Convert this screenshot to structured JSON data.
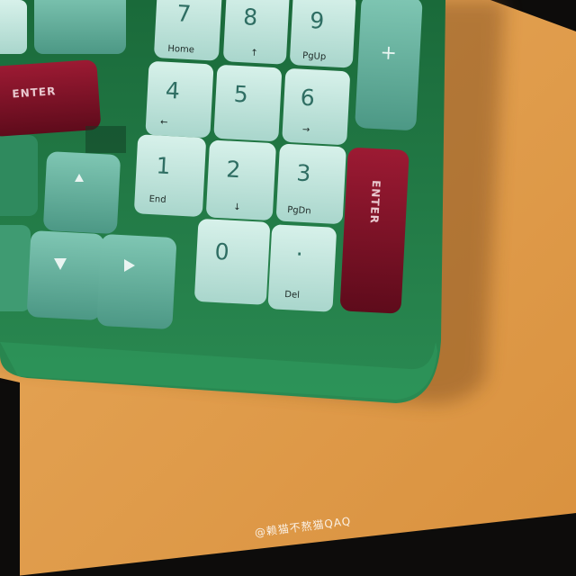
{
  "scene": {
    "subject": "keyboard-numpad-corner",
    "colors": {
      "case": "#1f7a45",
      "mint_key": "#b8dfd6",
      "sea_key": "#5fae9a",
      "red_key": "#7a1124",
      "desk": "#e3a14f",
      "legend": "#2f6e63"
    }
  },
  "keys": {
    "k7": {
      "main": "7",
      "sub": "Home"
    },
    "k8": {
      "main": "8",
      "sub": "↑"
    },
    "k9": {
      "main": "9",
      "sub": "PgUp"
    },
    "k4": {
      "main": "4",
      "sub": "←"
    },
    "k5": {
      "main": "5",
      "sub": ""
    },
    "k6": {
      "main": "6",
      "sub": "→"
    },
    "k1": {
      "main": "1",
      "sub": "End"
    },
    "k2": {
      "main": "2",
      "sub": "↓"
    },
    "k3": {
      "main": "3",
      "sub": "PgDn"
    },
    "k0": {
      "main": "0",
      "sub": ""
    },
    "kdot": {
      "main": "·",
      "sub": "Del"
    },
    "kplus": {
      "main": "+"
    },
    "enter_main": {
      "label": "ENTER"
    },
    "enter_numpad": {
      "label": "ENTER"
    }
  },
  "arrows": [
    "up-arrow-icon",
    "down-arrow-icon",
    "right-arrow-icon"
  ],
  "watermark": "@赖猫不熬猫QAQ"
}
